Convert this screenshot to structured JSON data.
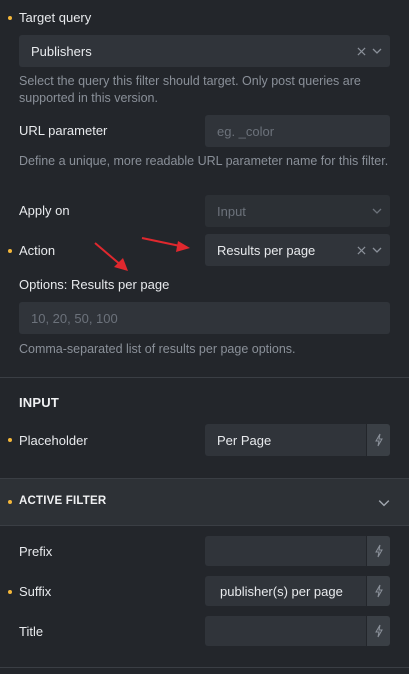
{
  "filter": {
    "target_query": {
      "label": "Target query",
      "value": "Publishers",
      "help": "Select the query this filter should target. Only post queries are supported in this version."
    },
    "url_parameter": {
      "label": "URL parameter",
      "placeholder": "eg. _color",
      "help": "Define a unique, more readable URL parameter name for this filter."
    },
    "apply_on": {
      "label": "Apply on",
      "value": "Input"
    },
    "action": {
      "label": "Action",
      "value": "Results per page"
    },
    "options": {
      "label": "Options: Results per page",
      "placeholder": "10, 20, 50, 100",
      "help": "Comma-separated list of results per page options."
    }
  },
  "input_section": {
    "title": "INPUT",
    "placeholder_label": "Placeholder",
    "placeholder_value": "Per Page"
  },
  "active_filter": {
    "title": "ACTIVE FILTER",
    "prefix_label": "Prefix",
    "prefix_value": "",
    "suffix_label": "Suffix",
    "suffix_value": "publisher(s) per page",
    "title_label": "Title",
    "title_value": ""
  },
  "colors": {
    "background": "#23262b",
    "field": "#30343a",
    "accent_dot": "#f4b73a",
    "annotation_arrow": "#e0282e"
  },
  "icons": [
    "clear-x-icon",
    "chevron-down-icon",
    "dynamic-data-bolt-icon",
    "annotation-arrow"
  ]
}
